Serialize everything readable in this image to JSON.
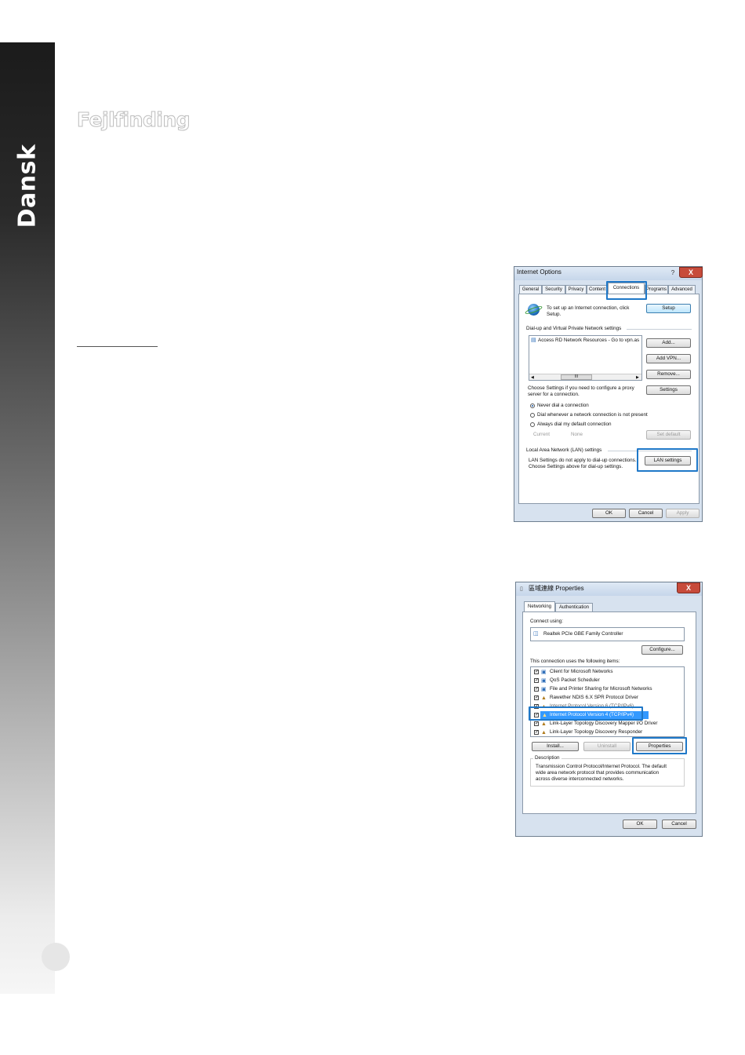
{
  "sidebar": {
    "language": "Dansk"
  },
  "section": {
    "title": "Fejlfinding"
  },
  "internet_options": {
    "title": "Internet Options",
    "help": "?",
    "close": "X",
    "tabs": [
      "General",
      "Security",
      "Privacy",
      "Content",
      "Connections",
      "Programs",
      "Advanced"
    ],
    "setup_text": [
      "To set up an Internet connection, click",
      "Setup."
    ],
    "setup_button": "Setup",
    "dialup_heading": "Dial-up and Virtual Private Network settings",
    "vpn_item": "Access RD Network Resources - Go to vpn.as",
    "scroll_thumb": "III",
    "add_button": "Add...",
    "add_vpn_button": "Add VPN...",
    "remove_button": "Remove...",
    "proxy_text": [
      "Choose Settings if you need to configure a proxy",
      "server for a connection."
    ],
    "settings_button": "Settings",
    "radio_options": [
      "Never dial a connection",
      "Dial whenever a network connection is not present",
      "Always dial my default connection"
    ],
    "current_label": "Current",
    "current_value": "None",
    "set_default_button": "Set default",
    "lan_heading": "Local Area Network (LAN) settings",
    "lan_text": [
      "LAN Settings do not apply to dial-up connections.",
      "Choose Settings above for dial-up settings."
    ],
    "lan_button": "LAN settings",
    "ok": "OK",
    "cancel": "Cancel",
    "apply": "Apply"
  },
  "nic_properties": {
    "title": "區域連線 Properties",
    "close": "X",
    "tabs": [
      "Networking",
      "Authentication"
    ],
    "connect_using_label": "Connect using:",
    "adapter": "Realtek PCIe GBE Family Controller",
    "configure_button": "Configure...",
    "items_label": "This connection uses the following items:",
    "items": [
      "Client for Microsoft Networks",
      "QoS Packet Scheduler",
      "File and Printer Sharing for Microsoft Networks",
      "Rawether NDIS 6.X SPR Protocol Driver",
      "Internet Protocol Version 6 (TCP/IPv6)",
      "Internet Protocol Version 4 (TCP/IPv4)",
      "Link-Layer Topology Discovery Mapper I/O Driver",
      "Link-Layer Topology Discovery Responder"
    ],
    "install_button": "Install...",
    "uninstall_button": "Uninstall",
    "properties_button": "Properties",
    "description_label": "Description",
    "description_text": [
      "Transmission Control Protocol/Internet Protocol. The default",
      "wide area network protocol that provides communication",
      "across diverse interconnected networks."
    ],
    "ok": "OK",
    "cancel": "Cancel"
  }
}
